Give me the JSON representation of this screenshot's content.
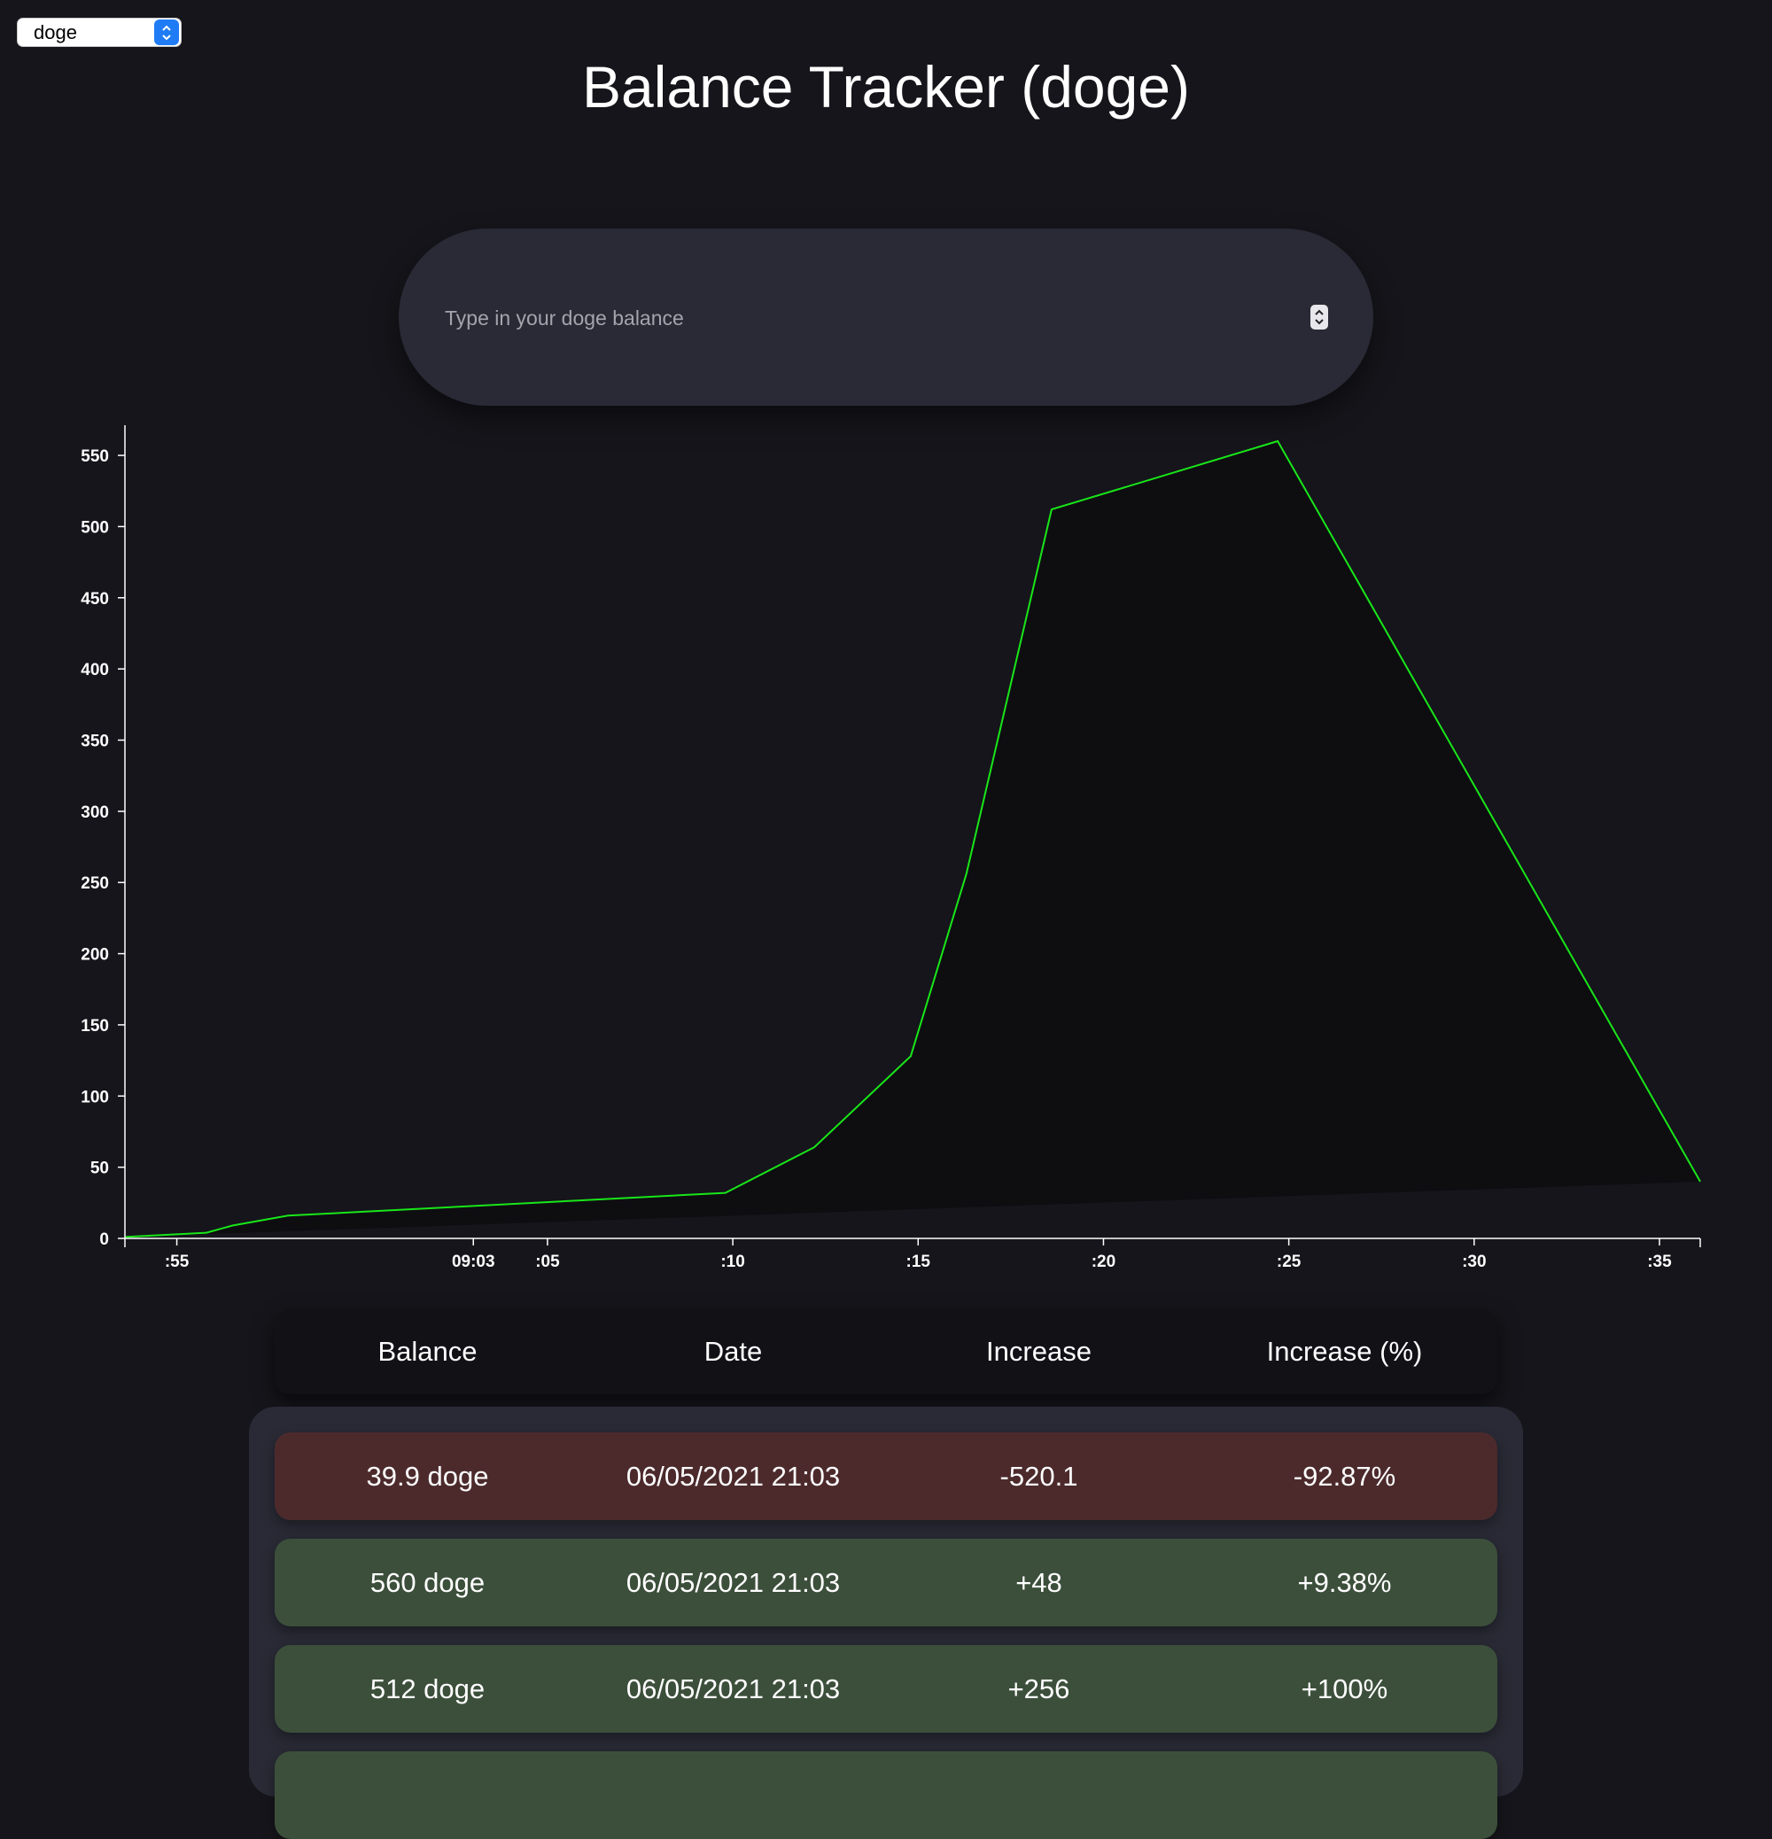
{
  "coin_select": {
    "value": "doge"
  },
  "title": "Balance Tracker (doge)",
  "balance_input": {
    "placeholder": "Type in your doge balance",
    "value": ""
  },
  "colors": {
    "background": "#15151b",
    "line": "#19e619",
    "area_fill": "#0e0e11",
    "row_decrease": "#4c2a2c",
    "row_increase": "#3c4f3b",
    "panel": "#292a35"
  },
  "chart_data": {
    "type": "area",
    "title": "",
    "xlabel": "",
    "ylabel": "",
    "ylim": [
      0,
      560
    ],
    "xlim_minutes": [
      53.6,
      96.1
    ],
    "y_ticks": [
      "0",
      "50",
      "100",
      "150",
      "200",
      "250",
      "300",
      "350",
      "400",
      "450",
      "500",
      "550"
    ],
    "x_ticks": [
      {
        "minute": 55,
        "label": ":55"
      },
      {
        "minute": 63,
        "label": "09:03"
      },
      {
        "minute": 65,
        "label": ":05"
      },
      {
        "minute": 70,
        "label": ":10"
      },
      {
        "minute": 75,
        "label": ":15"
      },
      {
        "minute": 80,
        "label": ":20"
      },
      {
        "minute": 85,
        "label": ":25"
      },
      {
        "minute": 90,
        "label": ":30"
      },
      {
        "minute": 95,
        "label": ":35"
      }
    ],
    "series": [
      {
        "points": [
          {
            "minute": 53.6,
            "value": 1
          },
          {
            "minute": 55.8,
            "value": 4
          },
          {
            "minute": 56.5,
            "value": 9
          },
          {
            "minute": 58.0,
            "value": 16
          },
          {
            "minute": 69.8,
            "value": 32
          },
          {
            "minute": 72.2,
            "value": 64
          },
          {
            "minute": 74.8,
            "value": 128
          },
          {
            "minute": 76.3,
            "value": 256
          },
          {
            "minute": 78.6,
            "value": 512
          },
          {
            "minute": 84.7,
            "value": 560
          },
          {
            "minute": 96.1,
            "value": 39.9
          }
        ]
      }
    ]
  },
  "table": {
    "headers": [
      "Balance",
      "Date",
      "Increase",
      "Increase (%)"
    ],
    "rows": [
      {
        "balance": "39.9 doge",
        "date": "06/05/2021 21:03",
        "increase": "-520.1",
        "percent": "-92.87%",
        "kind": "decrease"
      },
      {
        "balance": "560 doge",
        "date": "06/05/2021 21:03",
        "increase": "+48",
        "percent": "+9.38%",
        "kind": "increase"
      },
      {
        "balance": "512 doge",
        "date": "06/05/2021 21:03",
        "increase": "+256",
        "percent": "+100%",
        "kind": "increase"
      },
      {
        "balance": "",
        "date": "",
        "increase": "",
        "percent": "",
        "kind": "increase"
      }
    ]
  }
}
